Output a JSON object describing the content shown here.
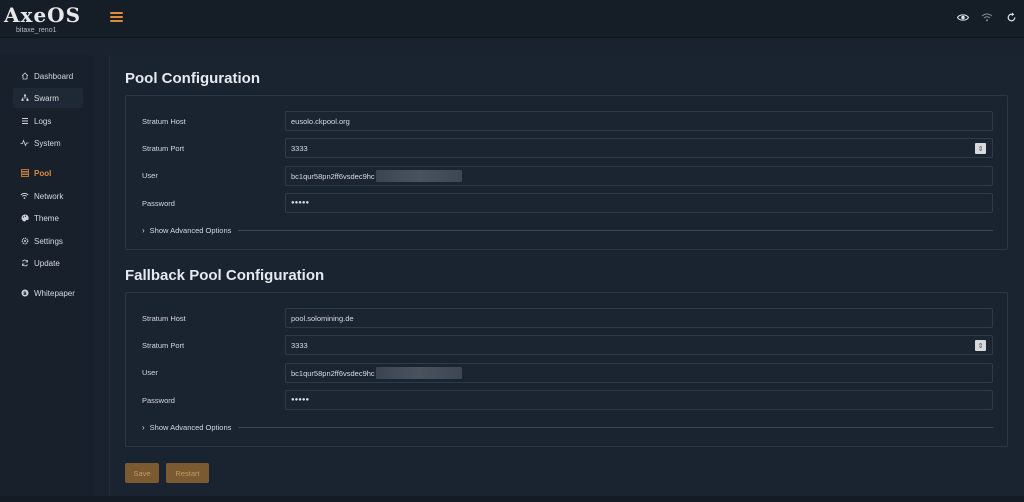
{
  "app": {
    "logo": "AxeOS",
    "hostname": "bitaxe_reno1"
  },
  "header": {
    "icons": [
      "menu-icon",
      "eye-icon",
      "wifi-icon",
      "refresh-icon"
    ],
    "accent_color": "#e0893a"
  },
  "sidebar": {
    "items": [
      {
        "label": "Dashboard",
        "icon": "home-icon"
      },
      {
        "label": "Swarm",
        "icon": "swarm-icon"
      },
      {
        "label": "Logs",
        "icon": "list-icon"
      },
      {
        "label": "System",
        "icon": "pulse-icon"
      },
      {
        "label": "Pool",
        "icon": "server-icon",
        "active": true
      },
      {
        "label": "Network",
        "icon": "wifi-icon"
      },
      {
        "label": "Theme",
        "icon": "palette-icon"
      },
      {
        "label": "Settings",
        "icon": "gear-icon"
      },
      {
        "label": "Update",
        "icon": "sync-icon"
      },
      {
        "label": "Whitepaper",
        "icon": "bitcoin-icon"
      }
    ]
  },
  "pool": {
    "title": "Pool Configuration",
    "stratum_host_label": "Stratum Host",
    "stratum_host": "eusolo.ckpool.org",
    "stratum_port_label": "Stratum Port",
    "stratum_port": "3333",
    "user_label": "User",
    "user": "bc1qur58pn2ff6vsdec9hc",
    "password_label": "Password",
    "password": "●●●●●",
    "advanced_label": "Show Advanced Options"
  },
  "fallback": {
    "title": "Fallback Pool Configuration",
    "stratum_host_label": "Stratum Host",
    "stratum_host": "pool.solomining.de",
    "stratum_port_label": "Stratum Port",
    "stratum_port": "3333",
    "user_label": "User",
    "user": "bc1qur58pn2ff6vsdec9hc",
    "password_label": "Password",
    "password": "●●●●●",
    "advanced_label": "Show Advanced Options"
  },
  "actions": {
    "save_label": "Save",
    "restart_label": "Restart"
  }
}
